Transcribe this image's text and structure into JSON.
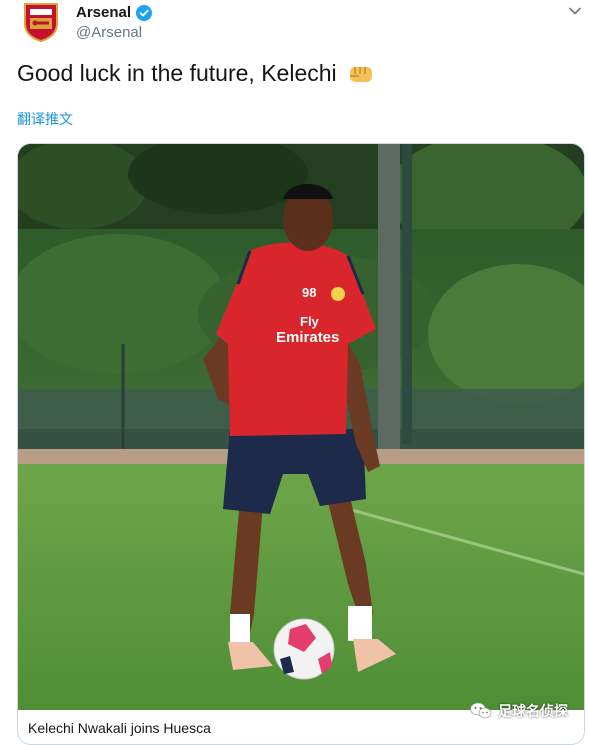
{
  "account": {
    "name": "Arsenal",
    "handle": "@Arsenal",
    "avatar_icon": "arsenal-crest-icon",
    "verified_icon": "verified-badge-icon"
  },
  "tweet": {
    "text": "Good luck in the future, Kelechi",
    "emoji_icon": "oncoming-fist-icon",
    "translate_link": "翻译推文"
  },
  "card": {
    "image_description_icon": "player-photo",
    "jersey_number": "98",
    "shirt_sponsor_line1": "Fly",
    "shirt_sponsor_line2": "Emirates",
    "title": "Kelechi Nwakali joins Huesca"
  },
  "watermark": {
    "text": "足球名侦探",
    "icon": "wechat-icon"
  },
  "colors": {
    "link": "#1b95e0",
    "handle_gray": "#657786",
    "jersey_red": "#d9262c",
    "shorts_navy": "#1d2a4a",
    "pitch_green": "#5c9c3c"
  }
}
